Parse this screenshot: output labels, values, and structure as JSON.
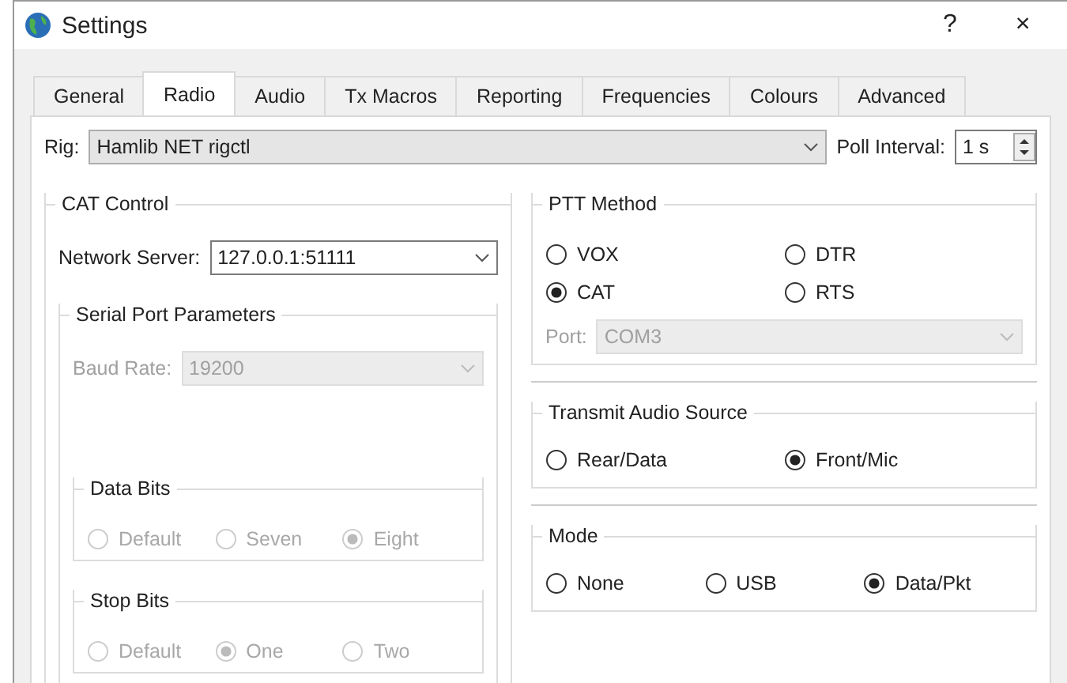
{
  "window": {
    "title": "Settings",
    "help": "?",
    "close": "×"
  },
  "tabs": [
    {
      "label": "General",
      "selected": false
    },
    {
      "label": "Radio",
      "selected": true
    },
    {
      "label": "Audio",
      "selected": false
    },
    {
      "label": "Tx Macros",
      "selected": false
    },
    {
      "label": "Reporting",
      "selected": false
    },
    {
      "label": "Frequencies",
      "selected": false
    },
    {
      "label": "Colours",
      "selected": false
    },
    {
      "label": "Advanced",
      "selected": false
    }
  ],
  "rig": {
    "label": "Rig:",
    "value": "Hamlib NET rigctl"
  },
  "poll_interval": {
    "label": "Poll Interval:",
    "value": "1 s"
  },
  "cat_control": {
    "title": "CAT Control",
    "network_server": {
      "label": "Network Server:",
      "value": "127.0.0.1:51111"
    },
    "serial_port": {
      "title": "Serial Port Parameters",
      "disabled": true,
      "baud_rate": {
        "label": "Baud Rate:",
        "value": "19200"
      },
      "groups": [
        {
          "title": "Data Bits",
          "options": [
            {
              "label": "Default",
              "selected": false
            },
            {
              "label": "Seven",
              "selected": false
            },
            {
              "label": "Eight",
              "selected": true
            }
          ]
        },
        {
          "title": "Stop Bits",
          "options": [
            {
              "label": "Default",
              "selected": false
            },
            {
              "label": "One",
              "selected": true
            },
            {
              "label": "Two",
              "selected": false
            }
          ]
        }
      ]
    }
  },
  "ptt_method": {
    "title": "PTT Method",
    "options": [
      {
        "label": "VOX",
        "selected": false
      },
      {
        "label": "DTR",
        "selected": false
      },
      {
        "label": "CAT",
        "selected": true
      },
      {
        "label": "RTS",
        "selected": false
      }
    ],
    "port": {
      "label": "Port:",
      "value": "COM3",
      "disabled": true
    }
  },
  "right_groups": [
    {
      "title": "Transmit Audio Source",
      "options": [
        {
          "label": "Rear/Data",
          "selected": false
        },
        {
          "label": "Front/Mic",
          "selected": true
        }
      ]
    },
    {
      "title": "Mode",
      "options": [
        {
          "label": "None",
          "selected": false
        },
        {
          "label": "USB",
          "selected": false
        },
        {
          "label": "Data/Pkt",
          "selected": true
        }
      ]
    }
  ]
}
